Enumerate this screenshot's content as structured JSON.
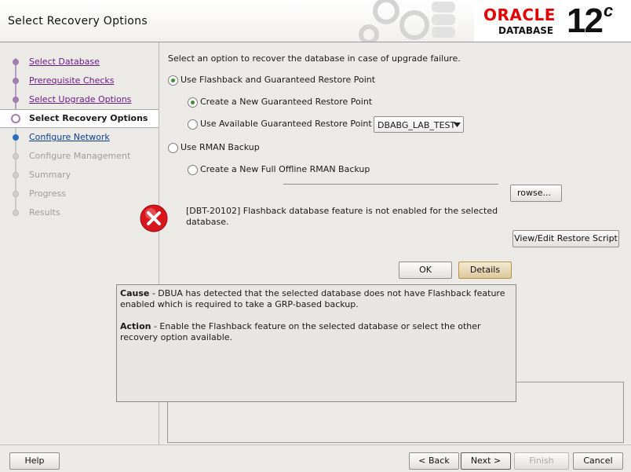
{
  "header": {
    "title": "Select Recovery Options",
    "brand": "ORACLE",
    "brand_sub": "DATABASE",
    "version": "12",
    "version_sup": "c"
  },
  "nav": {
    "steps": [
      {
        "label": "Select Database",
        "state": "done"
      },
      {
        "label": "Prerequisite Checks",
        "state": "done"
      },
      {
        "label": "Select Upgrade Options",
        "state": "done"
      },
      {
        "label": "Select Recovery Options",
        "state": "current"
      },
      {
        "label": "Configure Network",
        "state": "link"
      },
      {
        "label": "Configure Management",
        "state": "off"
      },
      {
        "label": "Summary",
        "state": "off"
      },
      {
        "label": "Progress",
        "state": "off"
      },
      {
        "label": "Results",
        "state": "off"
      }
    ]
  },
  "content": {
    "instruction": "Select an option to recover the database in case of upgrade failure.",
    "opt_flashback": "Use Flashback and Guaranteed Restore Point",
    "opt_create_grp": "Create a New Guaranteed Restore Point",
    "opt_use_grp": "Use Available Guaranteed Restore Point",
    "grp_combo_value": "DBABG_LAB_TEST",
    "opt_rman": "Use RMAN Backup",
    "opt_rman_new": "Create a New Full Offline RMAN Backup",
    "browse_label": "rowse...",
    "view_edit_label": "View/Edit Restore Script"
  },
  "dialog": {
    "message": "[DBT-20102] Flashback database feature is not enabled for the selected database.",
    "ok_label": "OK",
    "details_label": "Details",
    "cause_label": "Cause",
    "cause_text": " - DBUA has detected that the selected database does not have Flashback feature enabled which is required to take a GRP-based backup.",
    "action_label": "Action",
    "action_text": " - Enable the Flashback feature on the selected database or select the other recovery option available."
  },
  "footer": {
    "help_label": "Help",
    "back_label": "< Back",
    "next_label": "Next >",
    "finish_label": "Finish",
    "cancel_label": "Cancel"
  },
  "colors": {
    "oracle_red": "#e30000",
    "done_step": "#6b1c86",
    "link_step": "#0c3d8a",
    "radio_selected": "#3f8a3b",
    "error_icon": "#d8161c"
  }
}
